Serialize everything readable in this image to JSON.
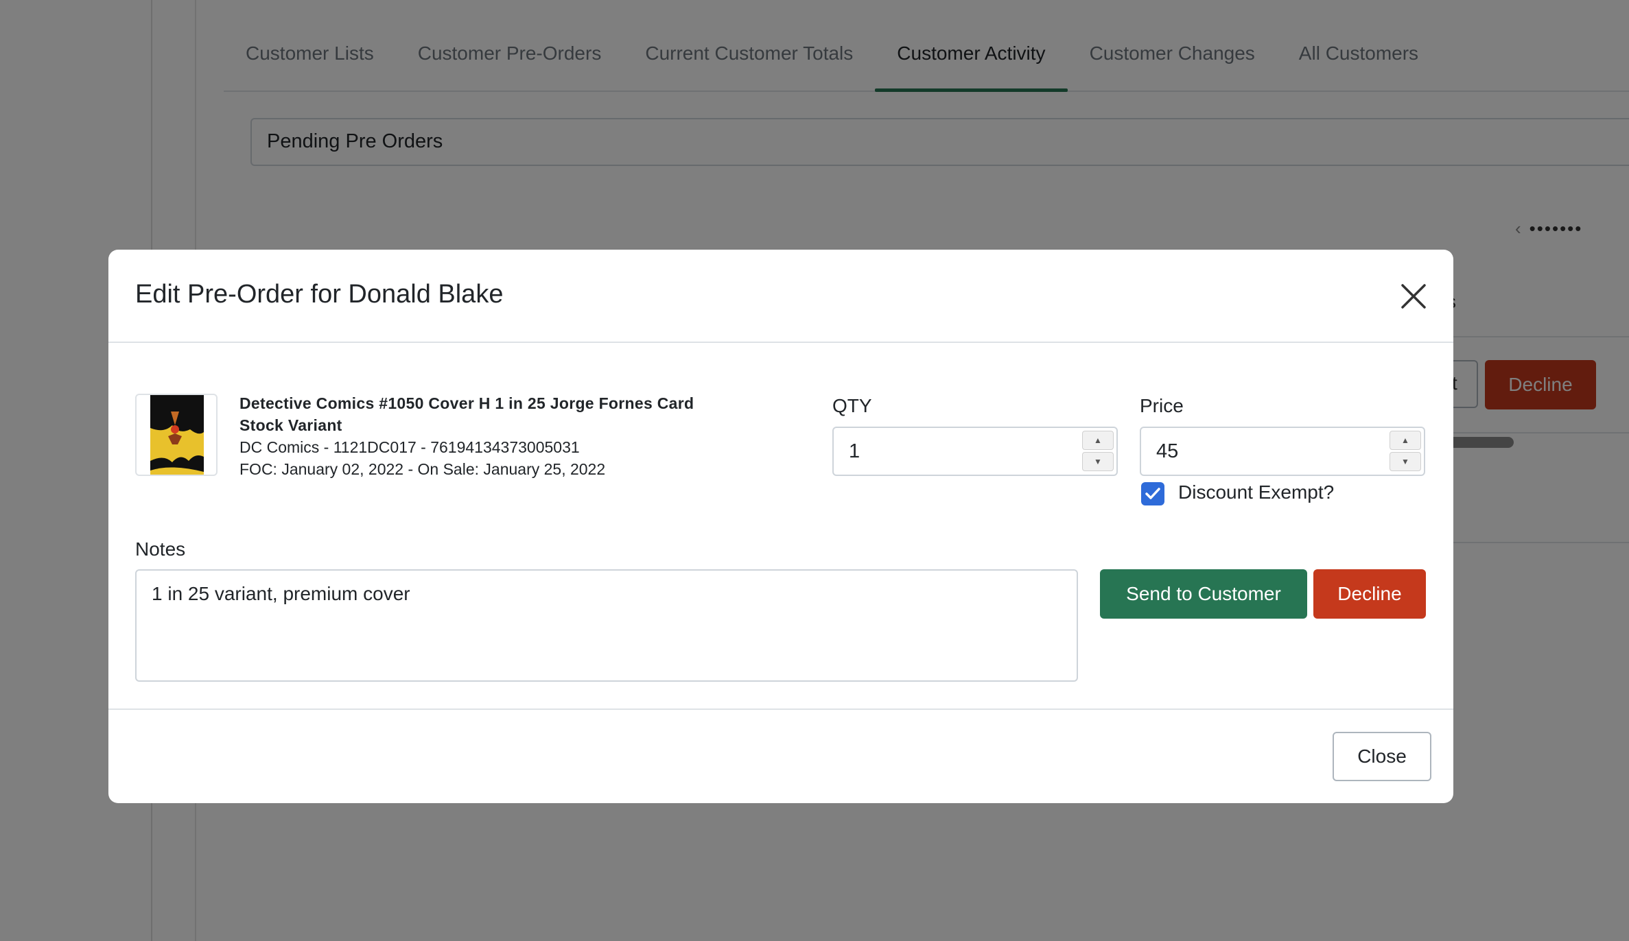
{
  "tabs": [
    {
      "label": "Customer Lists",
      "active": false
    },
    {
      "label": "Customer Pre-Orders",
      "active": false
    },
    {
      "label": "Current Customer Totals",
      "active": false
    },
    {
      "label": "Customer Activity",
      "active": true
    },
    {
      "label": "Customer Changes",
      "active": false
    },
    {
      "label": "All Customers",
      "active": false
    }
  ],
  "filter_select": {
    "value": "Pending Pre Orders"
  },
  "background": {
    "pager_dots": "•••••••",
    "partial_column_text": "s",
    "partial_button_text": "t",
    "decline_label": "Decline"
  },
  "modal": {
    "title": "Edit Pre-Order for Donald Blake",
    "product": {
      "title": "Detective Comics #1050 Cover H 1 in 25 Jorge Fornes Card Stock Variant",
      "details": "DC Comics - 1121DC017 - 76194134373005031",
      "dates": "FOC: January 02, 2022 -  On Sale: January 25, 2022"
    },
    "qty": {
      "label": "QTY",
      "value": "1"
    },
    "price": {
      "label": "Price",
      "value": "45"
    },
    "discount_exempt": {
      "label": "Discount Exempt?",
      "checked": true
    },
    "notes": {
      "label": "Notes",
      "value": "1 in 25 variant, premium cover"
    },
    "send_label": "Send to Customer",
    "decline_label": "Decline",
    "close_label": "Close"
  },
  "colors": {
    "accent_green": "#277553",
    "decline_red": "#c5391c",
    "checkbox_blue": "#2e6bd9"
  },
  "icons": {
    "close": "close-icon",
    "check": "check-icon",
    "spinner_up": "caret-up-icon",
    "spinner_down": "caret-down-icon",
    "pager_prev": "chevron-left-icon",
    "select_arrows": "select-arrows-icon"
  }
}
